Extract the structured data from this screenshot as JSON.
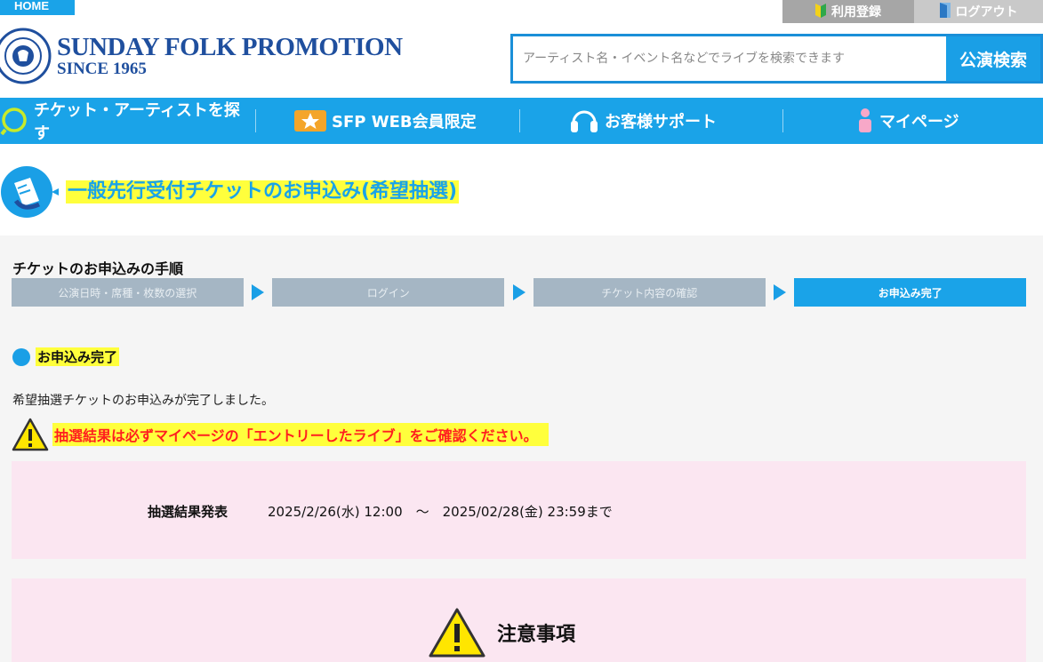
{
  "header": {
    "home_label": "HOME",
    "register_label": "利用登録",
    "logout_label": "ログアウト",
    "logo_title": "SUNDAY FOLK PROMOTION",
    "logo_sub": "SINCE 1965"
  },
  "search": {
    "placeholder": "アーティスト名・イベント名などでライブを検索できます",
    "button_label": "公演検索"
  },
  "nav": {
    "items": [
      {
        "label": "チケット・アーティストを探す",
        "icon": "search-icon"
      },
      {
        "label": "SFP WEB会員限定",
        "icon": "star-icon"
      },
      {
        "label": "お客様サポート",
        "icon": "headset-icon"
      },
      {
        "label": "マイページ",
        "icon": "person-icon"
      }
    ]
  },
  "page": {
    "title": "一般先行受付チケットのお申込み(希望抽選)"
  },
  "steps": {
    "title": "チケットのお申込みの手順",
    "items": [
      "公演日時・席種・枚数の選択",
      "ログイン",
      "チケット内容の確認",
      "お申込み完了"
    ],
    "active_index": 3
  },
  "section": {
    "label": "お申込み完了",
    "message": "希望抽選チケットのお申込みが完了しました。",
    "warning": "抽選結果は必ずマイページの「エントリーしたライブ」をご確認ください。"
  },
  "result": {
    "label": "抽選結果発表",
    "value": "2025/2/26(水) 12:00　～　2025/02/28(金) 23:59まで"
  },
  "notice": {
    "title": "注意事項"
  },
  "colors": {
    "brand_blue": "#1aa3e8",
    "highlight_yellow": "#ffff3c",
    "warning_red": "#ff1f1f",
    "pink_panel": "#fbe6f1"
  }
}
